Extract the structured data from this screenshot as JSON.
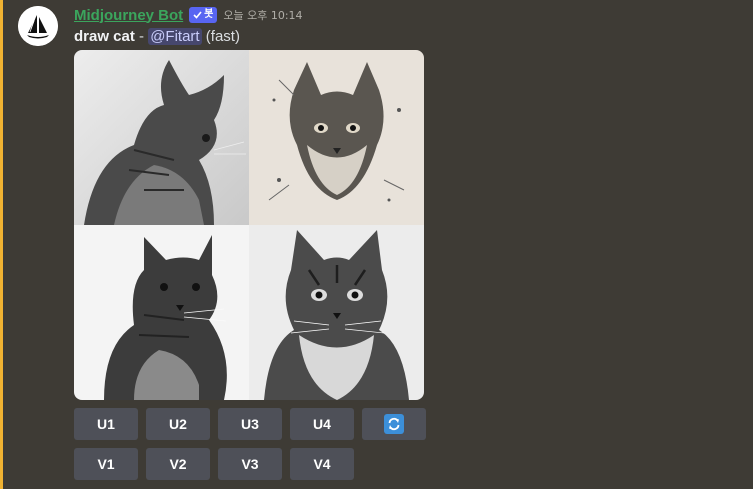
{
  "message": {
    "username": "Midjourney Bot",
    "bot_tag": "봇",
    "timestamp": "오늘 오후 10:14",
    "command": "draw cat",
    "separator": " - ",
    "mention": "@Fitart",
    "mode": "(fast)"
  },
  "image": {
    "icon": "image-grid",
    "alt": "draw cat"
  },
  "upscale_buttons": [
    {
      "label": "U1"
    },
    {
      "label": "U2"
    },
    {
      "label": "U3"
    },
    {
      "label": "U4"
    }
  ],
  "reroll_button": {
    "icon": "refresh-icon"
  },
  "variation_buttons": [
    {
      "label": "V1"
    },
    {
      "label": "V2"
    },
    {
      "label": "V3"
    },
    {
      "label": "V4"
    }
  ],
  "colors": {
    "background": "#3e3b35",
    "username": "#3ba55d",
    "bot_badge": "#5865f2",
    "mention_bar": "#f0b232",
    "button": "#4e5058",
    "reroll_icon": "#3c8fd9"
  }
}
